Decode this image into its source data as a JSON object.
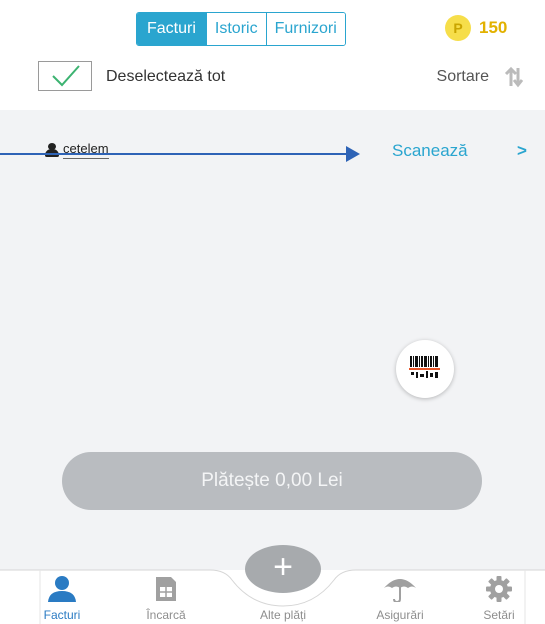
{
  "header": {
    "tabs": [
      {
        "label": "Facturi",
        "active": true
      },
      {
        "label": "Istoric",
        "active": false
      },
      {
        "label": "Furnizori",
        "active": false
      }
    ],
    "coin_symbol": "P",
    "points": "150"
  },
  "selection": {
    "deselect_label": "Deselectează tot",
    "sort_label": "Sortare",
    "checked": true
  },
  "provider": {
    "name": "cetelem",
    "scan_label": "Scanează",
    "chevron": ">"
  },
  "pay_button": {
    "label": "Plătește 0,00  Lei"
  },
  "fab": {
    "symbol": "+"
  },
  "bottom_nav": [
    {
      "label": "Facturi",
      "icon": "user-icon",
      "active": true
    },
    {
      "label": "Încarcă",
      "icon": "sim-card-icon",
      "active": false
    },
    {
      "label": "Alte plăți",
      "icon": "plus-icon",
      "active": false
    },
    {
      "label": "Asigurări",
      "icon": "umbrella-icon",
      "active": false
    },
    {
      "label": "Setări",
      "icon": "gear-icon",
      "active": false
    }
  ],
  "colors": {
    "accent": "#2aa5cf",
    "nav_active": "#2a7bc3",
    "annotation_arrow": "#2e63b6",
    "coin": "#f6de4a",
    "points_text": "#e2b100",
    "check": "#3cb371",
    "disabled_button": "#b9bcc0"
  }
}
